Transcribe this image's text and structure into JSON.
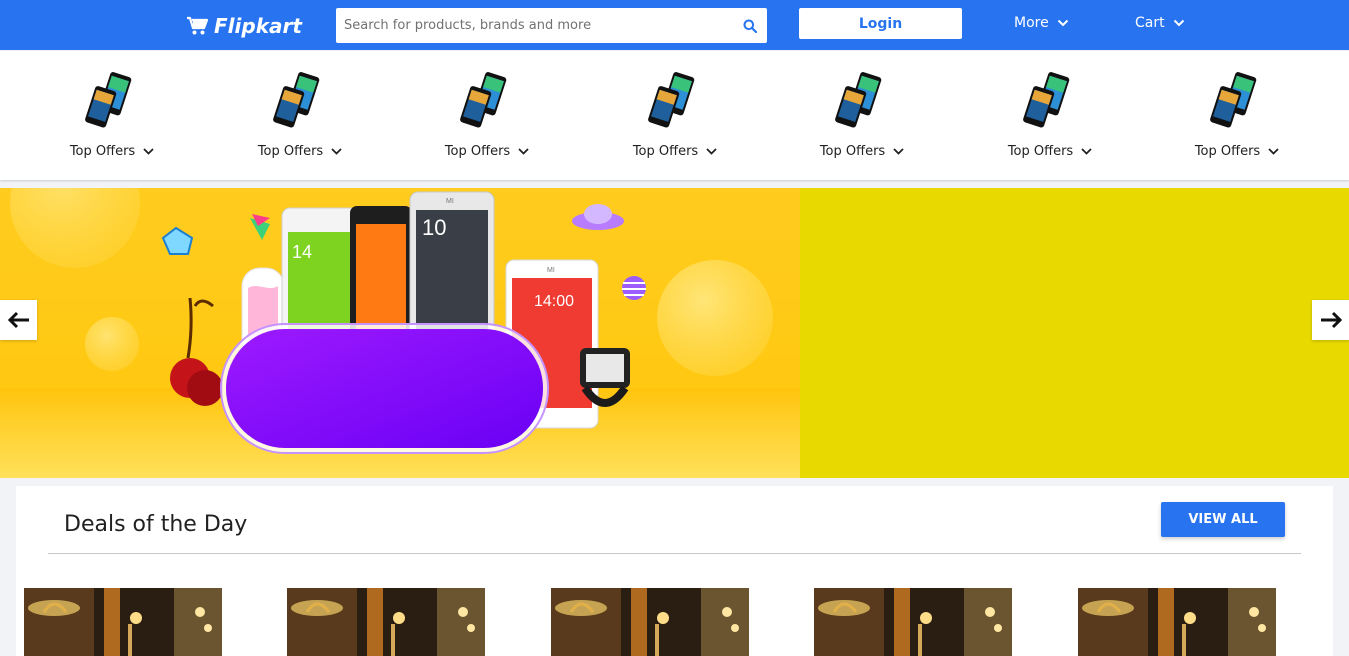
{
  "header": {
    "logo_text": "Flipkart",
    "logo_icon": "cart-icon",
    "search_placeholder": "Search for products, brands and more",
    "search_icon": "search-icon",
    "login_label": "Login",
    "more_label": "More",
    "cart_label": "Cart",
    "brand_color": "#2874f0"
  },
  "categories": [
    {
      "label": "Top Offers"
    },
    {
      "label": "Top Offers"
    },
    {
      "label": "Top Offers"
    },
    {
      "label": "Top Offers"
    },
    {
      "label": "Top Offers"
    },
    {
      "label": "Top Offers"
    },
    {
      "label": "Top Offers"
    }
  ],
  "banner": {
    "prev_icon": "arrow-left-icon",
    "next_icon": "arrow-right-icon",
    "phone_times": [
      "14",
      "10",
      "14:00"
    ],
    "phone_brand_marks": [
      "MI",
      "MI"
    ],
    "colors": {
      "background": "#ffc913",
      "pill": "#7b00ff",
      "right_panel": "#e8d800"
    }
  },
  "deals": {
    "title": "Deals of the Day",
    "view_all_label": "VIEW ALL",
    "items_count_visible": 5
  }
}
